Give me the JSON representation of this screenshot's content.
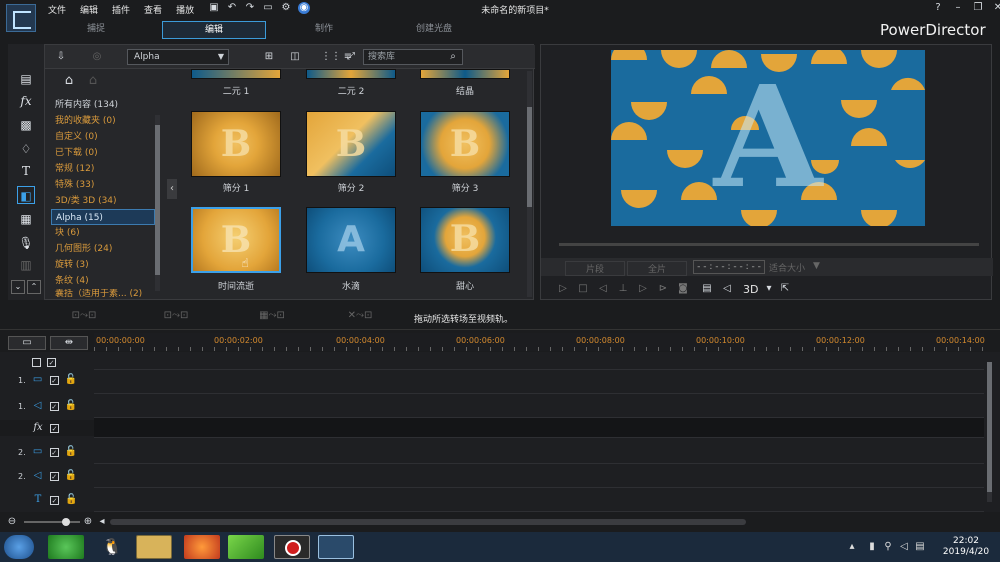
{
  "window": {
    "title": "未命名的新项目*",
    "brand": "PowerDirector",
    "help": "?",
    "min": "–",
    "restore": "❐",
    "close": "✕"
  },
  "menu": [
    "文件",
    "编辑",
    "插件",
    "查看",
    "播放"
  ],
  "mode_tabs": [
    {
      "label": "捕捉",
      "active": false
    },
    {
      "label": "编辑",
      "active": true
    },
    {
      "label": "制作",
      "active": false
    },
    {
      "label": "创建光盘",
      "active": false
    }
  ],
  "library": {
    "dropdown_value": "Alpha",
    "search_placeholder": "搜索库",
    "categories": [
      "所有内容 (134)",
      "我的收藏夹 (0)",
      "自定义 (0)",
      "已下载 (0)",
      "常规 (12)",
      "特殊 (33)",
      "3D/类 3D (34)",
      "Alpha (15)",
      "块 (6)",
      "几何图形 (24)",
      "旋转 (3)",
      "条纹 (4)",
      "囊括（适用于素... (2)"
    ],
    "selected_category_index": 7,
    "top_row_labels": [
      "二元 1",
      "二元 2",
      "结晶"
    ],
    "thumbnails": [
      {
        "label": "筛分 1",
        "glyph": "B"
      },
      {
        "label": "筛分 2",
        "glyph": "B"
      },
      {
        "label": "筛分 3",
        "glyph": "B"
      },
      {
        "label": "时间流逝",
        "glyph": "B"
      },
      {
        "label": "水滴",
        "glyph": "A"
      },
      {
        "label": "甜心",
        "glyph": "B"
      }
    ],
    "selected_thumbnail_index": 3
  },
  "preview": {
    "glyph": "A",
    "ctrl_labels": [
      "片段",
      "全片"
    ],
    "timecode": "- - : - - : - - : - -",
    "fit_label": "适合大小",
    "mode_3d": "3D"
  },
  "timeline": {
    "hint": "拖动所选转场至视频轨。",
    "ruler": [
      "00:00:00:00",
      "00:00:02:00",
      "00:00:04:00",
      "00:00:06:00",
      "00:00:08:00",
      "00:00:10:00",
      "00:00:12:00",
      "00:00:14:00"
    ],
    "tracks": [
      {
        "num": "",
        "kind": "all"
      },
      {
        "num": "1.",
        "kind": "video"
      },
      {
        "num": "1.",
        "kind": "audio"
      },
      {
        "num": "",
        "kind": "fx"
      },
      {
        "num": "2.",
        "kind": "video"
      },
      {
        "num": "2.",
        "kind": "audio"
      },
      {
        "num": "",
        "kind": "title"
      }
    ]
  },
  "taskbar": {
    "time": "22:02",
    "date": "2019/4/20"
  },
  "colors": {
    "accent": "#3ca0e8",
    "category_text": "#d99a3c",
    "ruler_text": "#d48a2e",
    "thumb_gold": "#e3a53a",
    "preview_blue": "#1a6b9e"
  }
}
